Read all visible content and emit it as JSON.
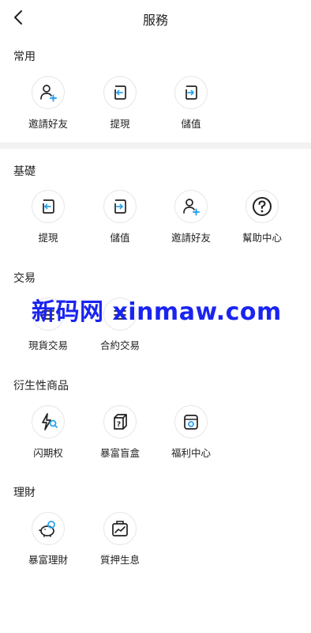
{
  "header": {
    "title": "服務"
  },
  "sections": {
    "common": {
      "title": "常用",
      "items": [
        "邀請好友",
        "提現",
        "儲值"
      ]
    },
    "basic": {
      "title": "基礎",
      "items": [
        "提現",
        "儲值",
        "邀請好友",
        "幫助中心"
      ]
    },
    "trade": {
      "title": "交易",
      "items": [
        "現貨交易",
        "合約交易"
      ]
    },
    "derivatives": {
      "title": "衍生性商品",
      "items": [
        "闪期权",
        "暴富盲盒",
        "福利中心"
      ]
    },
    "finance": {
      "title": "理財",
      "items": [
        "暴富理財",
        "質押生息"
      ]
    }
  },
  "watermark": {
    "text": "新码网 xinmaw.com"
  },
  "colors": {
    "accent": "#29a3ef",
    "text": "#222222",
    "divider": "#f2f2f2",
    "watermark": "#1a24f0"
  }
}
